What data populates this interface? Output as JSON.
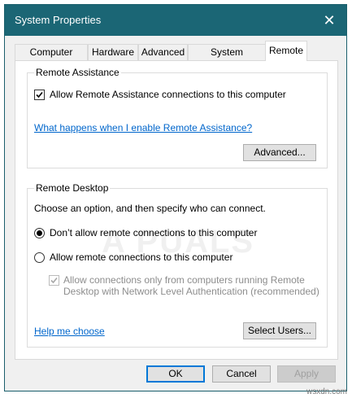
{
  "window": {
    "title": "System Properties",
    "close_glyph": "✕"
  },
  "tabs": [
    {
      "label": "Computer Name",
      "active": false
    },
    {
      "label": "Hardware",
      "active": false
    },
    {
      "label": "Advanced",
      "active": false
    },
    {
      "label": "System Protection",
      "active": false
    },
    {
      "label": "Remote",
      "active": true
    }
  ],
  "remote_assistance": {
    "group_label": "Remote Assistance",
    "allow_label": "Allow Remote Assistance connections to this computer",
    "allow_checked": true,
    "help_link": "What happens when I enable Remote Assistance?",
    "advanced_button": "Advanced..."
  },
  "remote_desktop": {
    "group_label": "Remote Desktop",
    "instruction": "Choose an option, and then specify who can connect.",
    "options": [
      {
        "label": "Don’t allow remote connections to this computer",
        "selected": true
      },
      {
        "label": "Allow remote connections to this computer",
        "selected": false
      }
    ],
    "nla_label_line1": "Allow connections only from computers running Remote",
    "nla_label_line2": "Desktop with Network Level Authentication (recommended)",
    "nla_checked": true,
    "nla_enabled": false,
    "help_link": "Help me choose",
    "select_users_button": "Select Users..."
  },
  "footer": {
    "ok": "OK",
    "cancel": "Cancel",
    "apply": "Apply"
  },
  "watermark": "A  PUALS",
  "credit": "wsxdn.com",
  "colors": {
    "titlebar": "#1b6675",
    "link": "#0066cc",
    "focus": "#0078d7"
  }
}
